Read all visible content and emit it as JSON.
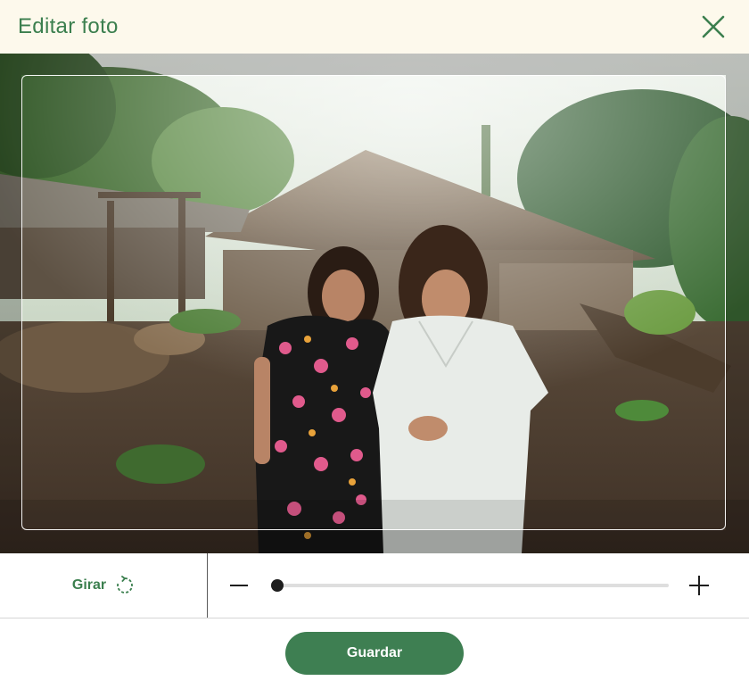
{
  "dialog": {
    "title": "Editar foto",
    "close_icon": "close-icon"
  },
  "image": {
    "subject": "photo",
    "crop_frame": "crop-frame"
  },
  "controls": {
    "rotate_label": "Girar",
    "rotate_icon": "rotate-clockwise-icon",
    "zoom_out_icon": "minus-icon",
    "zoom_in_icon": "plus-icon",
    "zoom_level": 0
  },
  "footer": {
    "save_label": "Guardar"
  },
  "colors": {
    "accent": "#3e7f52",
    "header_bg": "#fdf9ec",
    "title_color": "#3b7f4e"
  }
}
